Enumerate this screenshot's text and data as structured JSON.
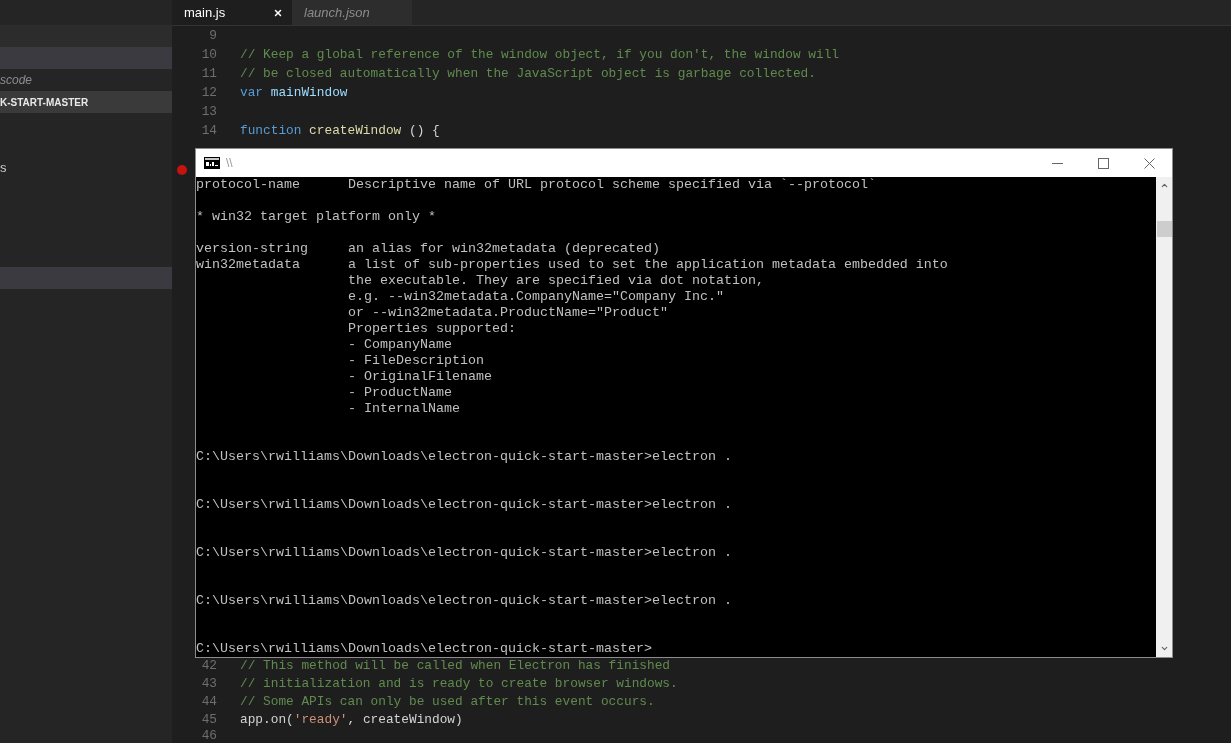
{
  "tabs": [
    {
      "label": "main.js",
      "selected": true,
      "preview": false
    },
    {
      "label": "launch.json",
      "selected": false,
      "preview": true
    }
  ],
  "sidebar": {
    "sections": [
      {
        "header": {
          "highlighted": false
        },
        "items": [
          {
            "selected": true
          },
          {
            "description": "scode",
            "selected": false
          }
        ]
      },
      {
        "header": {
          "label": "K-START-MASTER",
          "highlighted": true
        },
        "items": [
          {
            "selected": false
          },
          {
            "selected": false
          },
          {
            "label": "s",
            "selected": false
          },
          {
            "selected": false
          },
          {
            "selected": false
          },
          {
            "selected": false
          },
          {
            "selected": false
          },
          {
            "selected": true
          }
        ]
      }
    ]
  },
  "editor": {
    "blocks": [
      {
        "lines": [
          {
            "number": "9",
            "breakpoint": false
          },
          {
            "number": "10",
            "breakpoint": false,
            "tokens": [
              {
                "kind": "comment",
                "text": "// Keep a global reference of the window object, if you don't, the window will"
              }
            ]
          },
          {
            "number": "11",
            "breakpoint": false,
            "tokens": [
              {
                "kind": "comment",
                "text": "// be closed automatically when the JavaScript object is garbage collected."
              }
            ]
          },
          {
            "number": "12",
            "breakpoint": false,
            "tokens": [
              {
                "kind": "keyword",
                "text": "var"
              },
              {
                "kind": "variable",
                "text": " mainWindow"
              }
            ]
          },
          {
            "number": "13",
            "breakpoint": false
          },
          {
            "number": "14",
            "breakpoint": false,
            "tokens": [
              {
                "kind": "keyword",
                "text": "function"
              },
              {
                "kind": "function",
                "text": " createWindow"
              },
              {
                "kind": "plain",
                "text": " () {"
              }
            ]
          },
          {
            "breakpoint": false
          },
          {
            "breakpoint": true
          }
        ]
      },
      {
        "lines": [
          {
            "number": "42",
            "breakpoint": false,
            "tokens": [
              {
                "kind": "comment",
                "text": "// This method will be called when Electron has finished"
              }
            ]
          },
          {
            "number": "43",
            "breakpoint": false,
            "tokens": [
              {
                "kind": "comment",
                "text": "// initialization and is ready to create browser windows."
              }
            ]
          },
          {
            "number": "44",
            "breakpoint": false,
            "tokens": [
              {
                "kind": "comment",
                "text": "// Some APIs can only be used after this event occurs."
              }
            ]
          },
          {
            "number": "45",
            "breakpoint": false,
            "tokens": [
              {
                "kind": "plain",
                "text": "app.on("
              },
              {
                "kind": "string",
                "text": "'ready'"
              },
              {
                "kind": "plain",
                "text": ", createWindow)"
              }
            ]
          },
          {
            "number": "46",
            "breakpoint": false
          }
        ]
      }
    ]
  },
  "console": {
    "title": "\\\\",
    "lines": [
      {
        "kind": "option",
        "name": "protocol-name",
        "text": "Descriptive name of URL protocol scheme specified via `--protocol`"
      },
      {
        "kind": "blank"
      },
      {
        "kind": "text",
        "text": "* win32 target platform only *"
      },
      {
        "kind": "blank"
      },
      {
        "kind": "option",
        "name": "version-string",
        "text": "an alias for win32metadata (deprecated)"
      },
      {
        "kind": "option",
        "name": "win32metadata",
        "text": "a list of sub-properties used to set the application metadata embedded into"
      },
      {
        "kind": "continuation",
        "text": "the executable. They are specified via dot notation,"
      },
      {
        "kind": "continuation",
        "text": "e.g. --win32metadata.CompanyName=\"Company Inc.\""
      },
      {
        "kind": "continuation",
        "text": "or --win32metadata.ProductName=\"Product\""
      },
      {
        "kind": "continuation",
        "text": "Properties supported:"
      },
      {
        "kind": "continuation",
        "text": "- CompanyName"
      },
      {
        "kind": "continuation",
        "text": "- FileDescription"
      },
      {
        "kind": "continuation",
        "text": "- OriginalFilename"
      },
      {
        "kind": "continuation",
        "text": "- ProductName"
      },
      {
        "kind": "continuation",
        "text": "- InternalName"
      },
      {
        "kind": "blank"
      },
      {
        "kind": "blank"
      },
      {
        "kind": "prompt",
        "text": "C:\\Users\\rwilliams\\Downloads\\electron-quick-start-master>electron ."
      },
      {
        "kind": "blank"
      },
      {
        "kind": "blank"
      },
      {
        "kind": "prompt",
        "text": "C:\\Users\\rwilliams\\Downloads\\electron-quick-start-master>electron ."
      },
      {
        "kind": "blank"
      },
      {
        "kind": "blank"
      },
      {
        "kind": "prompt",
        "text": "C:\\Users\\rwilliams\\Downloads\\electron-quick-start-master>electron ."
      },
      {
        "kind": "blank"
      },
      {
        "kind": "blank"
      },
      {
        "kind": "prompt",
        "text": "C:\\Users\\rwilliams\\Downloads\\electron-quick-start-master>electron ."
      },
      {
        "kind": "blank"
      },
      {
        "kind": "blank"
      },
      {
        "kind": "prompt",
        "text": "C:\\Users\\rwilliams\\Downloads\\electron-quick-start-master>"
      }
    ]
  }
}
